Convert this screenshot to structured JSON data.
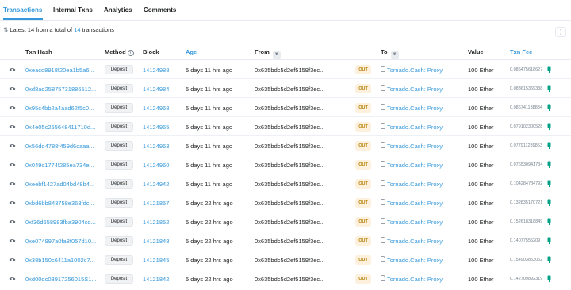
{
  "tabs": [
    {
      "label": "Transactions",
      "active": true
    },
    {
      "label": "Internal Txns",
      "active": false
    },
    {
      "label": "Analytics",
      "active": false
    },
    {
      "label": "Comments",
      "active": false
    }
  ],
  "summary": {
    "sort_icon": "sort-icon",
    "prefix": "Latest 14 from a total of ",
    "total": "14",
    "suffix": " transactions"
  },
  "more_button": "⋮",
  "columns": {
    "txn_hash": "Txn Hash",
    "method": "Method",
    "block": "Block",
    "age": "Age",
    "from": "From",
    "to": "To",
    "value": "Value",
    "txn_fee": "Txn Fee"
  },
  "colors": {
    "accent": "#3498db",
    "out_badge_bg": "#fdf0dc",
    "out_badge_text": "#b47d00",
    "gas_icon": "#00a186"
  },
  "rows": [
    {
      "hash": "0xeacd8918f20ea1b5a6...",
      "method": "Deposit",
      "block": "14124988",
      "age": "5 days 11 hrs ago",
      "from": "0x635bdc5d2ef5159f3ec...",
      "direction": "OUT",
      "to": "Tornado.Cash: Proxy",
      "value": "100 Ether",
      "fee": "0.085475618627"
    },
    {
      "hash": "0xd8ad25875731886512...",
      "method": "Deposit",
      "block": "14124984",
      "age": "5 days 11 hrs ago",
      "from": "0x635bdc5d2ef5159f3ec...",
      "direction": "OUT",
      "to": "Tornado.Cash: Proxy",
      "value": "100 Ether",
      "fee": "0.083615369338"
    },
    {
      "hash": "0x95c4bb2a4aad62f5c0...",
      "method": "Deposit",
      "block": "14124968",
      "age": "5 days 11 hrs ago",
      "from": "0x635bdc5d2ef5159f3ec...",
      "direction": "OUT",
      "to": "Tornado.Cash: Proxy",
      "value": "100 Ether",
      "fee": "0.086741138884"
    },
    {
      "hash": "0x4e05c255648411710d...",
      "method": "Deposit",
      "block": "14124965",
      "age": "5 days 11 hrs ago",
      "from": "0x635bdc5d2ef5159f3ec...",
      "direction": "OUT",
      "to": "Tornado.Cash: Proxy",
      "value": "100 Ether",
      "fee": "0.079102300528"
    },
    {
      "hash": "0x56dd4788f459d6caaa...",
      "method": "Deposit",
      "block": "14124963",
      "age": "5 days 11 hrs ago",
      "from": "0x635bdc5d2ef5159f3ec...",
      "direction": "OUT",
      "to": "Tornado.Cash: Proxy",
      "value": "100 Ether",
      "fee": "0.077911239853"
    },
    {
      "hash": "0x049c1774f285ea734e...",
      "method": "Deposit",
      "block": "14124960",
      "age": "5 days 11 hrs ago",
      "from": "0x635bdc5d2ef5159f3ec...",
      "direction": "OUT",
      "to": "Tornado.Cash: Proxy",
      "value": "100 Ether",
      "fee": "0.076530941734"
    },
    {
      "hash": "0xeebf1427ad04bd48b4...",
      "method": "Deposit",
      "block": "14124942",
      "age": "5 days 11 hrs ago",
      "from": "0x635bdc5d2ef5159f3ec...",
      "direction": "OUT",
      "to": "Tornado.Cash: Proxy",
      "value": "100 Ether",
      "fee": "0.104284784792"
    },
    {
      "hash": "0xbd6bb843758e363fdc...",
      "method": "Deposit",
      "block": "14121857",
      "age": "5 days 22 hrs ago",
      "from": "0x635bdc5d2ef5159f3ec...",
      "direction": "OUT",
      "to": "Tornado.Cash: Proxy",
      "value": "100 Ether",
      "fee": "0.132835170721"
    },
    {
      "hash": "0xf36d658983fba3904cd...",
      "method": "Deposit",
      "block": "14121852",
      "age": "5 days 22 hrs ago",
      "from": "0x635bdc5d2ef5159f3ec...",
      "direction": "OUT",
      "to": "Tornado.Cash: Proxy",
      "value": "100 Ether",
      "fee": "0.152618318849"
    },
    {
      "hash": "0xe074997a0fa8f057d10...",
      "method": "Deposit",
      "block": "14121848",
      "age": "5 days 22 hrs ago",
      "from": "0x635bdc5d2ef5159f3ec...",
      "direction": "OUT",
      "to": "Tornado.Cash: Proxy",
      "value": "100 Ether",
      "fee": "0.14077555209"
    },
    {
      "hash": "0x38b150c6411a1002c7...",
      "method": "Deposit",
      "block": "14121845",
      "age": "5 days 22 hrs ago",
      "from": "0x635bdc5d2ef5159f3ec...",
      "direction": "OUT",
      "to": "Tornado.Cash: Proxy",
      "value": "100 Ether",
      "fee": "0.154903853062"
    },
    {
      "hash": "0xd00dc03917256015S1...",
      "method": "Deposit",
      "block": "14121842",
      "age": "5 days 22 hrs ago",
      "from": "0x635bdc5d2ef5159f3ec...",
      "direction": "OUT",
      "to": "Tornado.Cash: Proxy",
      "value": "100 Ether",
      "fee": "0.142709892319"
    }
  ]
}
